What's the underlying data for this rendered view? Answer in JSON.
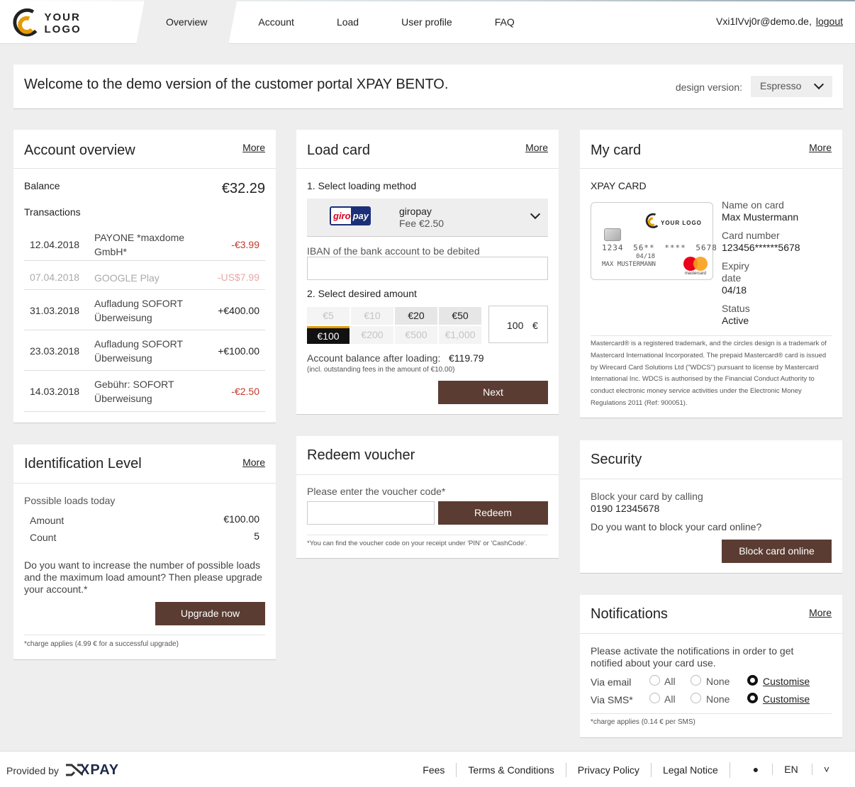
{
  "header": {
    "logo_text": "YOUR LOGO",
    "nav": [
      "Overview",
      "Account",
      "Load",
      "User profile",
      "FAQ"
    ],
    "user_email": "Vxi1lVvj0r@demo.de,",
    "logout": "logout",
    "colors": {
      "accent": "#e69b00",
      "button": "#5b3c32"
    }
  },
  "welcome": {
    "title": "Welcome to the demo version of the customer portal XPAY BENTO.",
    "design_label": "design version:",
    "design_value": "Espresso"
  },
  "account": {
    "title": "Account overview",
    "more": "More",
    "balance_label": "Balance",
    "balance": "€32.29",
    "transactions_label": "Transactions",
    "transactions": [
      {
        "date": "12.04.2018",
        "desc": "PAYONE *maxdome GmbH*",
        "amount": "-€3.99"
      },
      {
        "date": "07.04.2018",
        "desc": "GOOGLE Play",
        "amount": "-US$7.99"
      },
      {
        "date": "31.03.2018",
        "desc": "Aufladung SOFORT Überweisung",
        "amount": "+€400.00"
      },
      {
        "date": "23.03.2018",
        "desc": "Aufladung SOFORT Überweisung",
        "amount": "+€100.00"
      },
      {
        "date": "14.03.2018",
        "desc": "Gebühr: SOFORT Überweisung",
        "amount": "-€2.50"
      }
    ]
  },
  "load": {
    "title": "Load card",
    "more": "More",
    "step1": "1. Select loading method",
    "method_logo_a": "giro",
    "method_logo_b": "pay",
    "method_name": "giropay",
    "method_fee": "Fee €2.50",
    "iban_label": "IBAN of the bank account to be debited",
    "step2": "2. Select desired amount",
    "amounts": [
      "€5",
      "€10",
      "€20",
      "€50",
      "€100",
      "€200",
      "€500",
      "€1,000"
    ],
    "custom_amount": "100",
    "currency": "€",
    "after_label": "Account balance after loading:",
    "after_value": "€119.79",
    "fees_note": "(incl. outstanding fees in the amount of €10.00)",
    "next": "Next"
  },
  "mycard": {
    "title": "My card",
    "more": "More",
    "card_type": "XPAY CARD",
    "card_logo": "YOUR LOGO",
    "card_number_display": "1234 56** **** 5678",
    "card_expiry_display": "04/18",
    "card_holder_display": "MAX MUSTERMANN",
    "brand_small": "mastercard",
    "name_label": "Name on card",
    "name": "Max Mustermann",
    "number_label": "Card number",
    "number": "123456******5678",
    "expiry_label_1": "Expiry",
    "expiry_label_2": "date",
    "expiry": "04/18",
    "status_label": "Status",
    "status": "Active",
    "legal": "Mastercard® is a registered trademark, and the circles design is a trademark of Mastercard International Incorporated. The prepaid Mastercard® card is issued by Wirecard Card Solutions Ltd (\"WDCS\") pursuant to license by Mastercard International Inc. WDCS is authorised by the Financial Conduct Authority to conduct electronic money service activities under the Electronic Money Regulations 2011 (Ref: 900051)."
  },
  "ident": {
    "title": "Identification Level",
    "more": "More",
    "possible": "Possible loads today",
    "amount_label": "Amount",
    "amount": "€100.00",
    "count_label": "Count",
    "count": "5",
    "upgrade_text": "Do you want to increase the number of possible loads and the maximum load amount? Then please upgrade your account.*",
    "upgrade_btn": "Upgrade now",
    "note": "*charge applies (4.99 € for a successful upgrade)"
  },
  "voucher": {
    "title": "Redeem voucher",
    "label": "Please enter the voucher code*",
    "button": "Redeem",
    "note": "*You can find the voucher code on your receipt under 'PIN' or 'CashCode'."
  },
  "security": {
    "title": "Security",
    "block_text": "Block your card by calling",
    "phone": "0190 12345678",
    "question": "Do you want to block your card online?",
    "button": "Block card online"
  },
  "notifications": {
    "title": "Notifications",
    "more": "More",
    "text": "Please activate the notifications in order to get notified about your card use.",
    "rows": [
      {
        "label": "Via email",
        "all": "All",
        "none": "None",
        "customise": "Customise"
      },
      {
        "label": "Via SMS*",
        "all": "All",
        "none": "None",
        "customise": "Customise"
      }
    ],
    "note": "*charge applies (0.14 € per SMS)"
  },
  "footer": {
    "provided": "Provided by",
    "brand": "XPAY",
    "links": [
      "Fees",
      "Terms & Conditions",
      "Privacy Policy",
      "Legal Notice"
    ],
    "lang": "EN"
  }
}
